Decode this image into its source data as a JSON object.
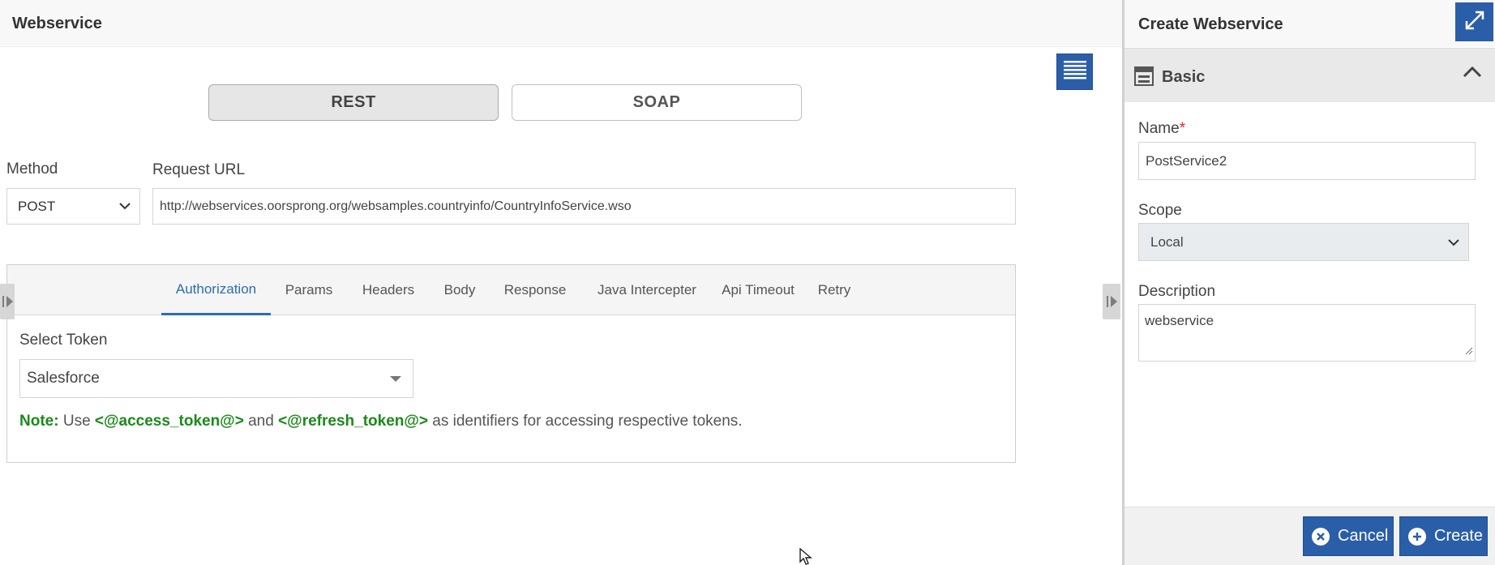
{
  "main": {
    "title": "Webservice",
    "toggle": {
      "rest": "REST",
      "soap": "SOAP",
      "active": "REST"
    },
    "method_label": "Method",
    "method_value": "POST",
    "url_label": "Request URL",
    "url_value": "http://webservices.oorsprong.org/websamples.countryinfo/CountryInfoService.wso",
    "tabs": [
      {
        "label": "Authorization",
        "active": true
      },
      {
        "label": "Params"
      },
      {
        "label": "Headers"
      },
      {
        "label": "Body"
      },
      {
        "label": "Response"
      },
      {
        "label": "Java Intercepter"
      },
      {
        "label": "Api Timeout"
      },
      {
        "label": "Retry"
      }
    ],
    "select_token_label": "Select Token",
    "select_token_value": "Salesforce",
    "note": {
      "prefix": "Note:",
      "t1": " Use ",
      "access": "<@access_token@>",
      "t2": " and ",
      "refresh": "<@refresh_token@>",
      "t3": " as identifiers for accessing respective tokens."
    }
  },
  "side": {
    "title": "Create Webservice",
    "section": "Basic",
    "name_label": "Name",
    "name_required": "*",
    "name_value": "PostService2",
    "scope_label": "Scope",
    "scope_value": "Local",
    "description_label": "Description",
    "description_value": "webservice",
    "cancel_label": "Cancel",
    "create_label": "Create"
  },
  "colors": {
    "accent": "#2a5ea8",
    "tab_active": "#2a6db3",
    "note_green": "#1a8a1a",
    "required": "#d9262c"
  },
  "icons": [
    "list-icon",
    "expand-icon",
    "form-icon",
    "chevron-up-icon",
    "chevron-down-icon",
    "caret-down-icon",
    "close-circle-icon",
    "plus-circle-icon",
    "panel-toggle-icon",
    "mouse-cursor-icon"
  ]
}
